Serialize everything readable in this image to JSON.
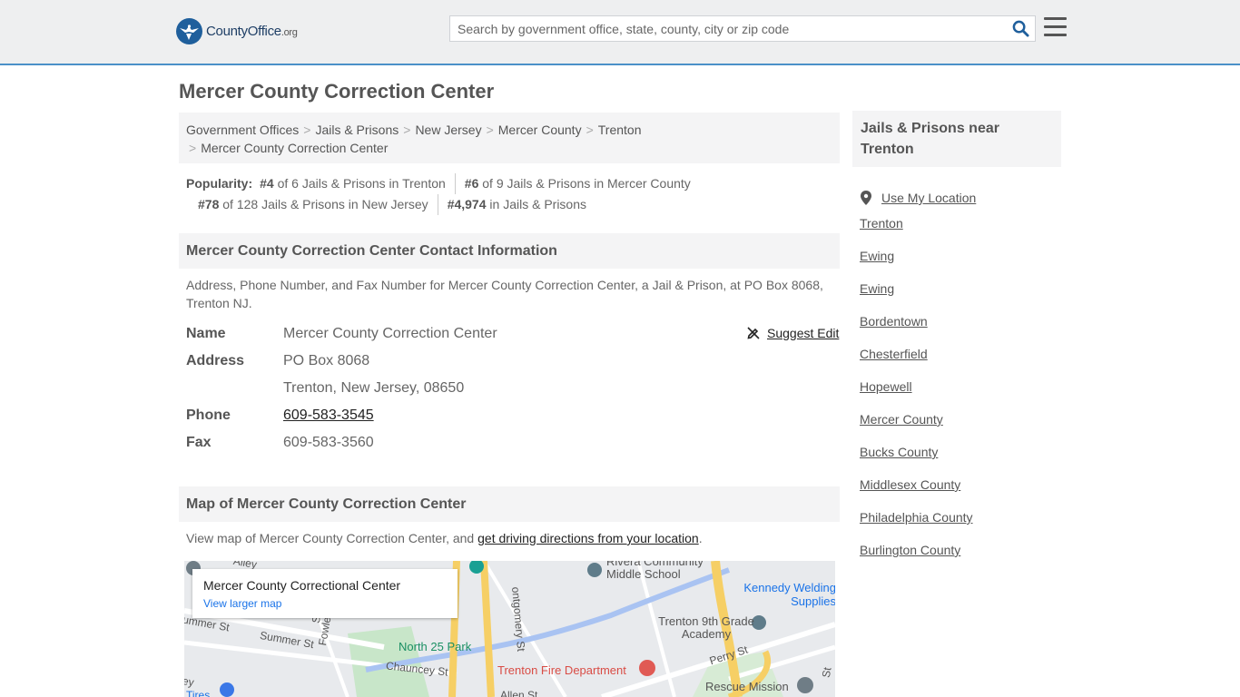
{
  "header": {
    "logo_name": "CountyOffice",
    "logo_tld": ".org",
    "search_placeholder": "Search by government office, state, county, city or zip code"
  },
  "page": {
    "title": "Mercer County Correction Center"
  },
  "breadcrumb": [
    "Government Offices",
    "Jails & Prisons",
    "New Jersey",
    "Mercer County",
    "Trenton",
    "Mercer County Correction Center"
  ],
  "popularity": {
    "label": "Popularity:",
    "items": [
      {
        "rank": "#4",
        "text": " of 6 Jails & Prisons in Trenton"
      },
      {
        "rank": "#6",
        "text": " of 9 Jails & Prisons in Mercer County"
      },
      {
        "rank": "#78",
        "text": " of 128 Jails & Prisons in New Jersey"
      },
      {
        "rank": "#4,974",
        "text": " in Jails & Prisons"
      }
    ]
  },
  "contact": {
    "heading": "Mercer County Correction Center Contact Information",
    "description": "Address, Phone Number, and Fax Number for Mercer County Correction Center, a Jail & Prison, at PO Box 8068, Trenton NJ.",
    "suggest_edit": "Suggest Edit",
    "fields": [
      {
        "label": "Name",
        "value": "Mercer County Correction Center"
      },
      {
        "label": "Address",
        "value": "PO Box 8068"
      },
      {
        "label": "",
        "value": "Trenton, New Jersey, 08650"
      },
      {
        "label": "Phone",
        "value": "609-583-3545"
      },
      {
        "label": "Fax",
        "value": "609-583-3560"
      }
    ]
  },
  "map": {
    "heading": "Map of Mercer County Correction Center",
    "description_prefix": "View map of Mercer County Correction Center, and ",
    "directions_link": "get driving directions from your location",
    "description_suffix": ".",
    "card_title": "Mercer County Correctional Center",
    "card_link": "View larger map",
    "labels": {
      "school": "Rivera Community Middle School",
      "kennedy": "Kennedy Welding Supplies",
      "academy": "Trenton 9th Grade Academy",
      "park": "North 25 Park",
      "fire": "Trenton Fire Department",
      "rescue": "Rescue Mission",
      "summer": "Summer St",
      "chauncey": "Chauncey St",
      "perry": "Perry St",
      "montgomery": "ontgomery St",
      "fowler": "Fowler St",
      "mmer": "ummer St",
      "alley": "Alley",
      "allen": "Allen St",
      "tires": "Tires",
      "st1": "St",
      "st2": "St",
      "ey": "ey"
    }
  },
  "sidebar": {
    "heading": "Jails & Prisons near Trenton",
    "use_location": "Use My Location",
    "links": [
      "Trenton",
      "Ewing",
      "Ewing",
      "Bordentown",
      "Chesterfield",
      "Hopewell",
      "Mercer County",
      "Bucks County",
      "Middlesex County",
      "Philadelphia County",
      "Burlington County"
    ]
  }
}
